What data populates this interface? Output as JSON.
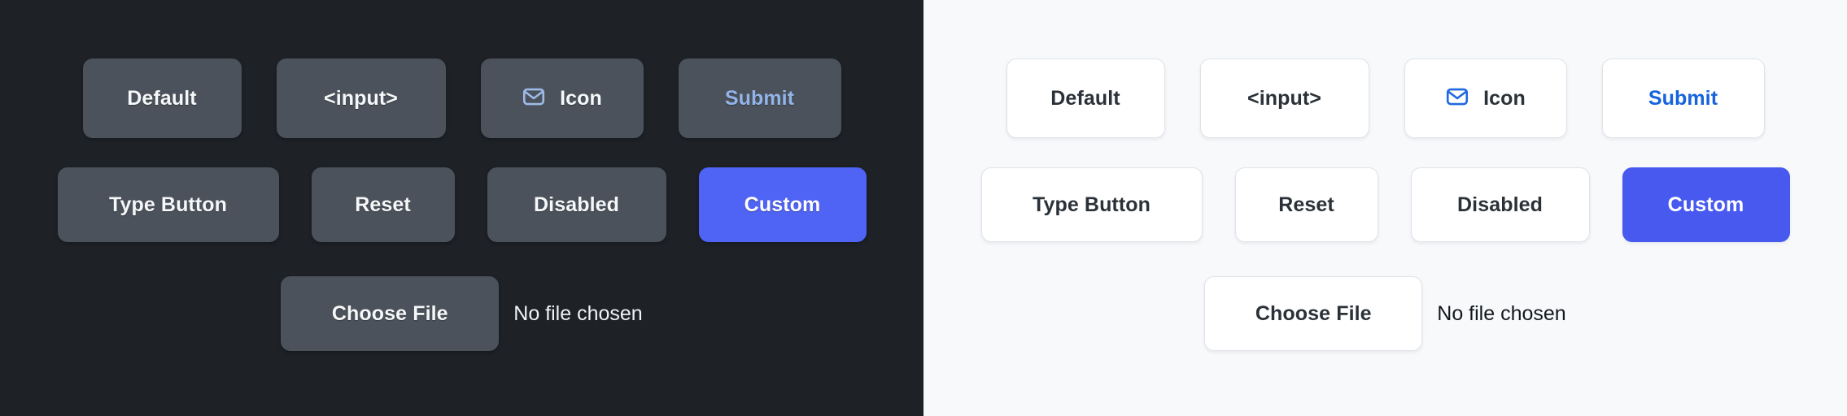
{
  "panels": [
    {
      "theme": "dark",
      "background": "#1e2227",
      "surface": "#4b525b",
      "text": "#f6f7f8",
      "accent": "#93b4e8",
      "custom_bg": "#4f64f5",
      "row1": [
        {
          "label": "Default",
          "name": "default-button"
        },
        {
          "label": "<input>",
          "name": "input-button"
        },
        {
          "label": "Icon",
          "name": "icon-button",
          "icon": "envelope-icon"
        },
        {
          "label": "Submit",
          "name": "submit-button",
          "accent": true
        }
      ],
      "row2": [
        {
          "label": "Type Button",
          "name": "type-button"
        },
        {
          "label": "Reset",
          "name": "reset-button"
        },
        {
          "label": "Disabled",
          "name": "disabled-button"
        },
        {
          "label": "Custom",
          "name": "custom-button",
          "custom": true
        }
      ],
      "file": {
        "button_label": "Choose File",
        "status_text": "No file chosen"
      }
    },
    {
      "theme": "light",
      "background": "#f8f9fb",
      "surface": "#ffffff",
      "text": "#2b3138",
      "accent": "#1564dd",
      "custom_bg": "#4759ef",
      "row1": [
        {
          "label": "Default",
          "name": "default-button"
        },
        {
          "label": "<input>",
          "name": "input-button"
        },
        {
          "label": "Icon",
          "name": "icon-button",
          "icon": "envelope-icon"
        },
        {
          "label": "Submit",
          "name": "submit-button",
          "accent": true
        }
      ],
      "row2": [
        {
          "label": "Type Button",
          "name": "type-button"
        },
        {
          "label": "Reset",
          "name": "reset-button"
        },
        {
          "label": "Disabled",
          "name": "disabled-button"
        },
        {
          "label": "Custom",
          "name": "custom-button",
          "custom": true
        }
      ],
      "file": {
        "button_label": "Choose File",
        "status_text": "No file chosen"
      }
    }
  ]
}
